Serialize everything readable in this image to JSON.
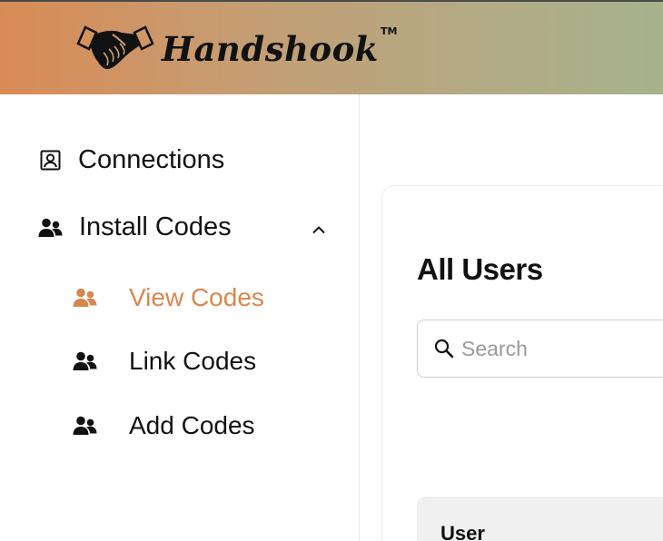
{
  "brand": {
    "name": "Handshook",
    "trademark": "TM"
  },
  "colors": {
    "accent": "#d8874f",
    "header_start": "#d98b55",
    "header_end": "#a6b38d"
  },
  "sidebar": {
    "items": [
      {
        "label": "Connections",
        "icon": "contact-card-icon"
      },
      {
        "label": "Install Codes",
        "icon": "users-icon",
        "expanded": true,
        "children": [
          {
            "label": "View Codes",
            "icon": "users-icon",
            "active": true
          },
          {
            "label": "Link Codes",
            "icon": "users-icon"
          },
          {
            "label": "Add Codes",
            "icon": "users-icon"
          }
        ]
      }
    ]
  },
  "main": {
    "title": "All Users",
    "search": {
      "placeholder": "Search",
      "value": ""
    },
    "table": {
      "columns": [
        "User"
      ]
    }
  }
}
